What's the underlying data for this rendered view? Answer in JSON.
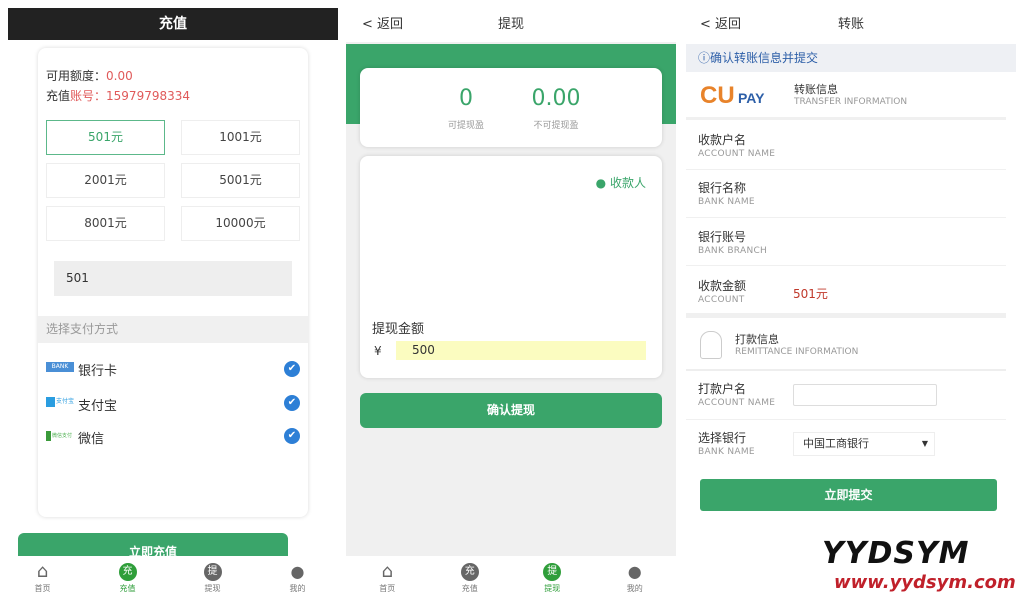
{
  "recharge": {
    "title": "充值",
    "balance_label": "可用额度：",
    "balance": "0.00",
    "account_label_a": "充值",
    "account_label_b": "账号：",
    "account": "15979798334",
    "amounts": [
      "501元",
      "1001元",
      "2001元",
      "5001元",
      "8001元",
      "10000元"
    ],
    "amount_input": "501",
    "section": "选择支付方式",
    "methods": [
      {
        "badge": "BANK",
        "label": "银行卡"
      },
      {
        "badge": "支付宝",
        "label": "支付宝"
      },
      {
        "badge": "微信支付",
        "label": "微信"
      }
    ],
    "submit": "立即充值",
    "check": "✔"
  },
  "tabs": [
    {
      "icon": "⌂",
      "label": "首页"
    },
    {
      "icon": "充",
      "label": "充值"
    },
    {
      "icon": "提",
      "label": "提现"
    },
    {
      "icon": "●",
      "label": "我的"
    }
  ],
  "withdraw": {
    "back": "< 返回",
    "title": "提现",
    "available": "0",
    "available_label": "可提现盈",
    "unavailable": "0.00",
    "unavailable_label": "不可提现盈",
    "payee": "收款人",
    "amount_label": "提现金额",
    "currency": "¥",
    "amount": "500",
    "confirm": "确认提现"
  },
  "transfer": {
    "back": "< 返回",
    "title": "转账",
    "notice": "ⓘ确认转账信息并提交",
    "logo_cu": "CU",
    "logo_pay": "PAY",
    "info_title": "转账信息",
    "info_sub": "TRANSFER INFORMATION",
    "fields": [
      {
        "label": "收款户名",
        "sub": "ACCOUNT NAME",
        "value": ""
      },
      {
        "label": "银行名称",
        "sub": "BANK NAME",
        "value": ""
      },
      {
        "label": "银行账号",
        "sub": "BANK BRANCH",
        "value": ""
      },
      {
        "label": "收款金额",
        "sub": "ACCOUNT",
        "value": "501元"
      }
    ],
    "remit_title": "打款信息",
    "remit_sub": "REMITTANCE INFORMATION",
    "payer_label": "打款户名",
    "payer_sub": "ACCOUNT NAME",
    "payer_value": "",
    "bank_label": "选择银行",
    "bank_sub": "BANK NAME",
    "bank_selected": "中国工商银行",
    "submit": "立即提交"
  },
  "watermark": {
    "brand": "YYDSYM",
    "url": "www.yydsym.com"
  },
  "colors": {
    "green": "#3aa56a",
    "red": "#e05a5a",
    "blue": "#2d7fd6",
    "orange": "#e8832a"
  }
}
